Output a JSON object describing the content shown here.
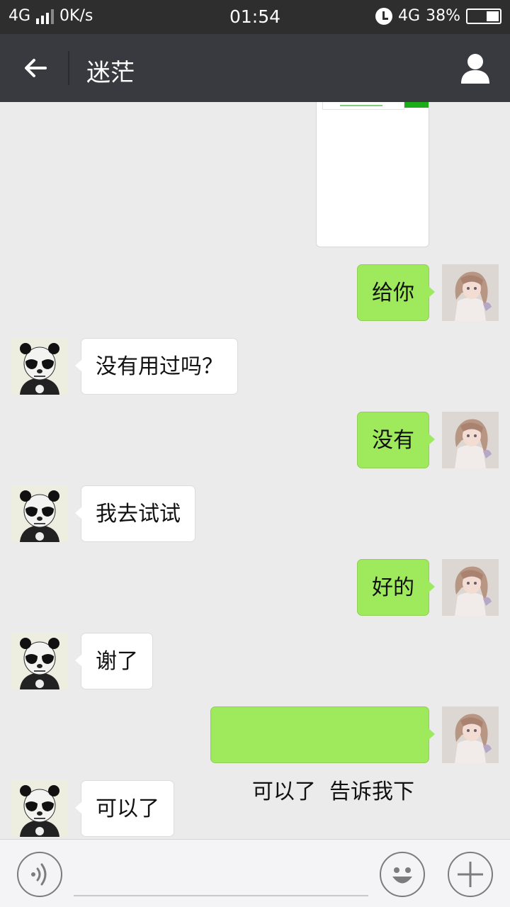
{
  "status_bar": {
    "network": "4G",
    "speed": "0K/s",
    "time": "01:54",
    "network2": "4G",
    "battery": "38%",
    "battery_level": 0.38
  },
  "header": {
    "title": "迷茫"
  },
  "messages": [
    {
      "side": "out",
      "text": "给你"
    },
    {
      "side": "in",
      "text": "没有用过吗？"
    },
    {
      "side": "out",
      "text": "没有"
    },
    {
      "side": "in",
      "text": "我去试试"
    },
    {
      "side": "out",
      "text": "好的"
    },
    {
      "side": "in",
      "text": "谢了"
    },
    {
      "side": "out",
      "text": "可以了  告诉我下"
    },
    {
      "side": "in",
      "text": "可以了"
    }
  ],
  "icons": {
    "back": "arrow-left-icon",
    "profile": "person-icon",
    "voice": "voice-icon",
    "emoji": "emoji-icon",
    "more": "plus-icon"
  },
  "colors": {
    "outgoing_bubble": "#9fe95d",
    "incoming_bubble": "#ffffff",
    "nav_bar": "#393a3f",
    "background": "#ebebeb"
  }
}
